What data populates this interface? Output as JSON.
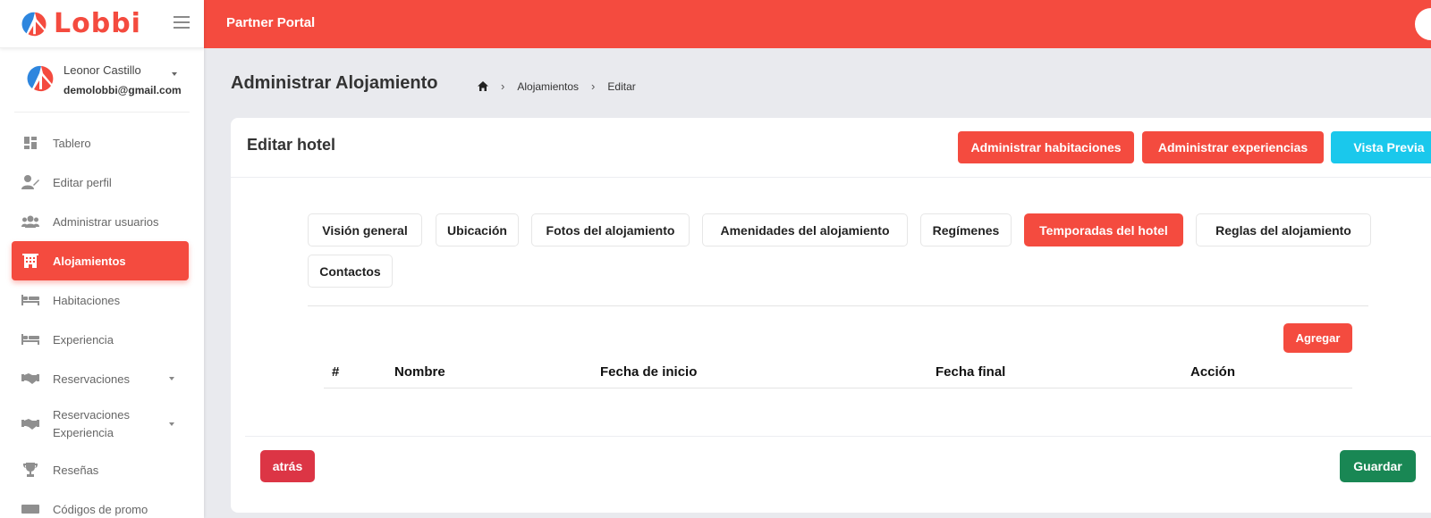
{
  "brand": {
    "name": "Lobbi",
    "color": "#f44b3f"
  },
  "topbar": {
    "title": "Partner Portal"
  },
  "user": {
    "name": "Leonor Castillo",
    "email": "demolobbi@gmail.com"
  },
  "sidebar": {
    "items": [
      {
        "label": "Tablero",
        "icon": "dashboard-icon"
      },
      {
        "label": "Editar perfil",
        "icon": "user-edit-icon"
      },
      {
        "label": "Administrar usuarios",
        "icon": "users-icon"
      },
      {
        "label": "Alojamientos",
        "icon": "building-icon",
        "active": true
      },
      {
        "label": "Habitaciones",
        "icon": "bed-icon"
      },
      {
        "label": "Experiencia",
        "icon": "bed-icon"
      },
      {
        "label": "Reservaciones",
        "icon": "handshake-icon",
        "dropdown": true
      },
      {
        "label": "Reservaciones Experiencia",
        "icon": "handshake-icon",
        "dropdown": true
      },
      {
        "label": "Reseñas",
        "icon": "trophy-icon"
      },
      {
        "label": "Códigos de promo",
        "icon": "ticket-icon"
      }
    ]
  },
  "page": {
    "title": "Administrar Alojamiento",
    "breadcrumb": [
      "Alojamientos",
      "Editar"
    ]
  },
  "card": {
    "title": "Editar hotel",
    "buttons": {
      "rooms": "Administrar habitaciones",
      "experiences": "Administrar experiencias",
      "preview": "Vista Previa"
    },
    "tabs": [
      "Visión general",
      "Ubicación",
      "Fotos del alojamiento",
      "Amenidades del alojamiento",
      "Regímenes",
      "Temporadas del hotel",
      "Reglas del alojamiento",
      "Contactos"
    ],
    "active_tab": "Temporadas del hotel",
    "add_label": "Agregar",
    "table": {
      "headers": [
        "#",
        "Nombre",
        "Fecha de inicio",
        "Fecha final",
        "Acción"
      ],
      "rows": []
    },
    "back_label": "atrás",
    "save_label": "Guardar"
  },
  "colors": {
    "primary": "#f44b3f",
    "cyan": "#1ac8ec",
    "danger": "#dc3545",
    "success": "#198754"
  }
}
